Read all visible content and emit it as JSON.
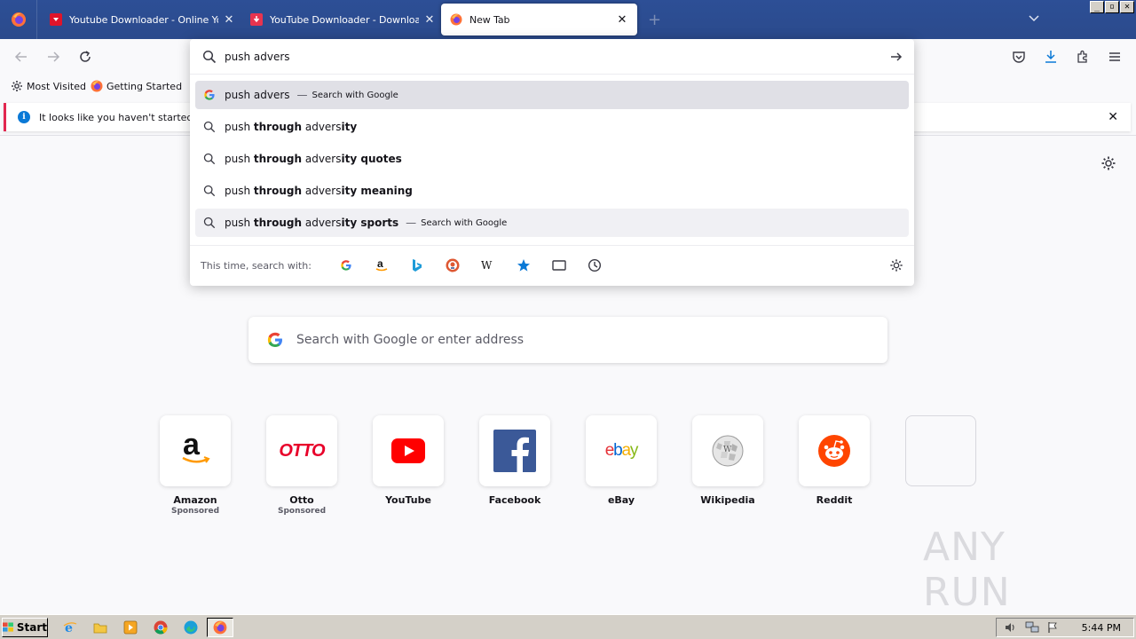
{
  "tabs": [
    {
      "title": "Youtube Downloader - Online Youtube",
      "active": false
    },
    {
      "title": "YouTube Downloader - Download Videos",
      "active": false
    },
    {
      "title": "New Tab",
      "active": true
    }
  ],
  "url_bar": {
    "value": "push advers",
    "suggestions": [
      {
        "pre": "push advers",
        "bold": "",
        "post": "",
        "action": "Search with Google",
        "icon": "google-icon",
        "state": "selected"
      },
      {
        "pre": "push ",
        "bold": "through",
        "mid": " advers",
        "bold2": "ity",
        "tail": "",
        "action": "",
        "icon": "search-icon"
      },
      {
        "pre": "push ",
        "bold": "through",
        "mid": " advers",
        "bold2": "ity quotes",
        "tail": "",
        "action": "",
        "icon": "search-icon"
      },
      {
        "pre": "push ",
        "bold": "through",
        "mid": " advers",
        "bold2": "ity meaning",
        "tail": "",
        "action": "",
        "icon": "search-icon"
      },
      {
        "pre": "push ",
        "bold": "through",
        "mid": " advers",
        "bold2": "ity sports",
        "tail": "",
        "action": "Search with Google",
        "icon": "search-icon",
        "state": "hover"
      }
    ],
    "separator": "—",
    "one_off_label": "This time, search with:",
    "engines": [
      "google-icon",
      "amazon-icon",
      "bing-icon",
      "duckduckgo-icon",
      "wikipedia-icon",
      "bookmarks-star-icon",
      "tabs-icon",
      "history-icon"
    ]
  },
  "bookmarks": [
    {
      "label": "Most Visited",
      "icon": "gear-icon"
    },
    {
      "label": "Getting Started",
      "icon": "firefox-icon"
    }
  ],
  "notification": {
    "text": "It looks like you haven't started Fire",
    "icon": "info-icon"
  },
  "newtab": {
    "search_placeholder": "Search with Google or enter address",
    "tiles": [
      {
        "label": "Amazon",
        "sponsored": "Sponsored",
        "icon": "amazon-logo"
      },
      {
        "label": "Otto",
        "sponsored": "Sponsored",
        "icon": "otto-logo"
      },
      {
        "label": "YouTube",
        "sponsored": "",
        "icon": "youtube-logo"
      },
      {
        "label": "Facebook",
        "sponsored": "",
        "icon": "facebook-logo"
      },
      {
        "label": "eBay",
        "sponsored": "",
        "icon": "ebay-logo"
      },
      {
        "label": "Wikipedia",
        "sponsored": "",
        "icon": "wikipedia-logo"
      },
      {
        "label": "Reddit",
        "sponsored": "",
        "icon": "reddit-logo"
      },
      {
        "label": "",
        "sponsored": "",
        "icon": ""
      }
    ],
    "otto_text": "OTTO",
    "ebay_text": "ebay",
    "amazon_text": "a"
  },
  "taskbar": {
    "start_label": "Start",
    "clock": "5:44 PM"
  },
  "watermark": "ANY RUN",
  "colors": {
    "tabstrip": "#2b4a8c",
    "accent": "#0b79d6",
    "notif_stripe": "#e22850",
    "youtube_red": "#e0142a"
  }
}
